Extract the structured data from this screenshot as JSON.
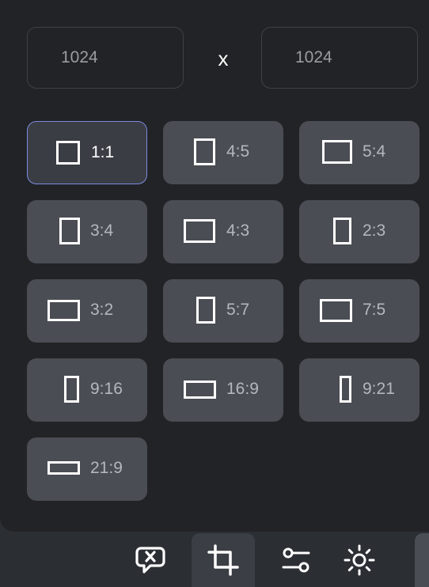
{
  "dimensions": {
    "width": "1024",
    "separator": "x",
    "height": "1024"
  },
  "aspect_ratios": [
    {
      "label": "1:1",
      "selected": true
    },
    {
      "label": "4:5",
      "selected": false
    },
    {
      "label": "5:4",
      "selected": false
    },
    {
      "label": "3:4",
      "selected": false
    },
    {
      "label": "4:3",
      "selected": false
    },
    {
      "label": "2:3",
      "selected": false
    },
    {
      "label": "3:2",
      "selected": false
    },
    {
      "label": "5:7",
      "selected": false
    },
    {
      "label": "7:5",
      "selected": false
    },
    {
      "label": "9:16",
      "selected": false
    },
    {
      "label": "16:9",
      "selected": false
    },
    {
      "label": "9:21",
      "selected": false
    },
    {
      "label": "21:9",
      "selected": false
    }
  ],
  "toolbar": {
    "tools": [
      {
        "icon": "chat-close-icon",
        "active": false
      },
      {
        "icon": "crop-icon",
        "active": true
      },
      {
        "icon": "sliders-icon",
        "active": false
      },
      {
        "icon": "brightness-icon",
        "active": false
      }
    ]
  },
  "colors": {
    "panel_bg": "#212326",
    "button_bg": "#4a4d53",
    "selected_border": "#7d8be0",
    "text_muted": "#b4b7bc"
  }
}
